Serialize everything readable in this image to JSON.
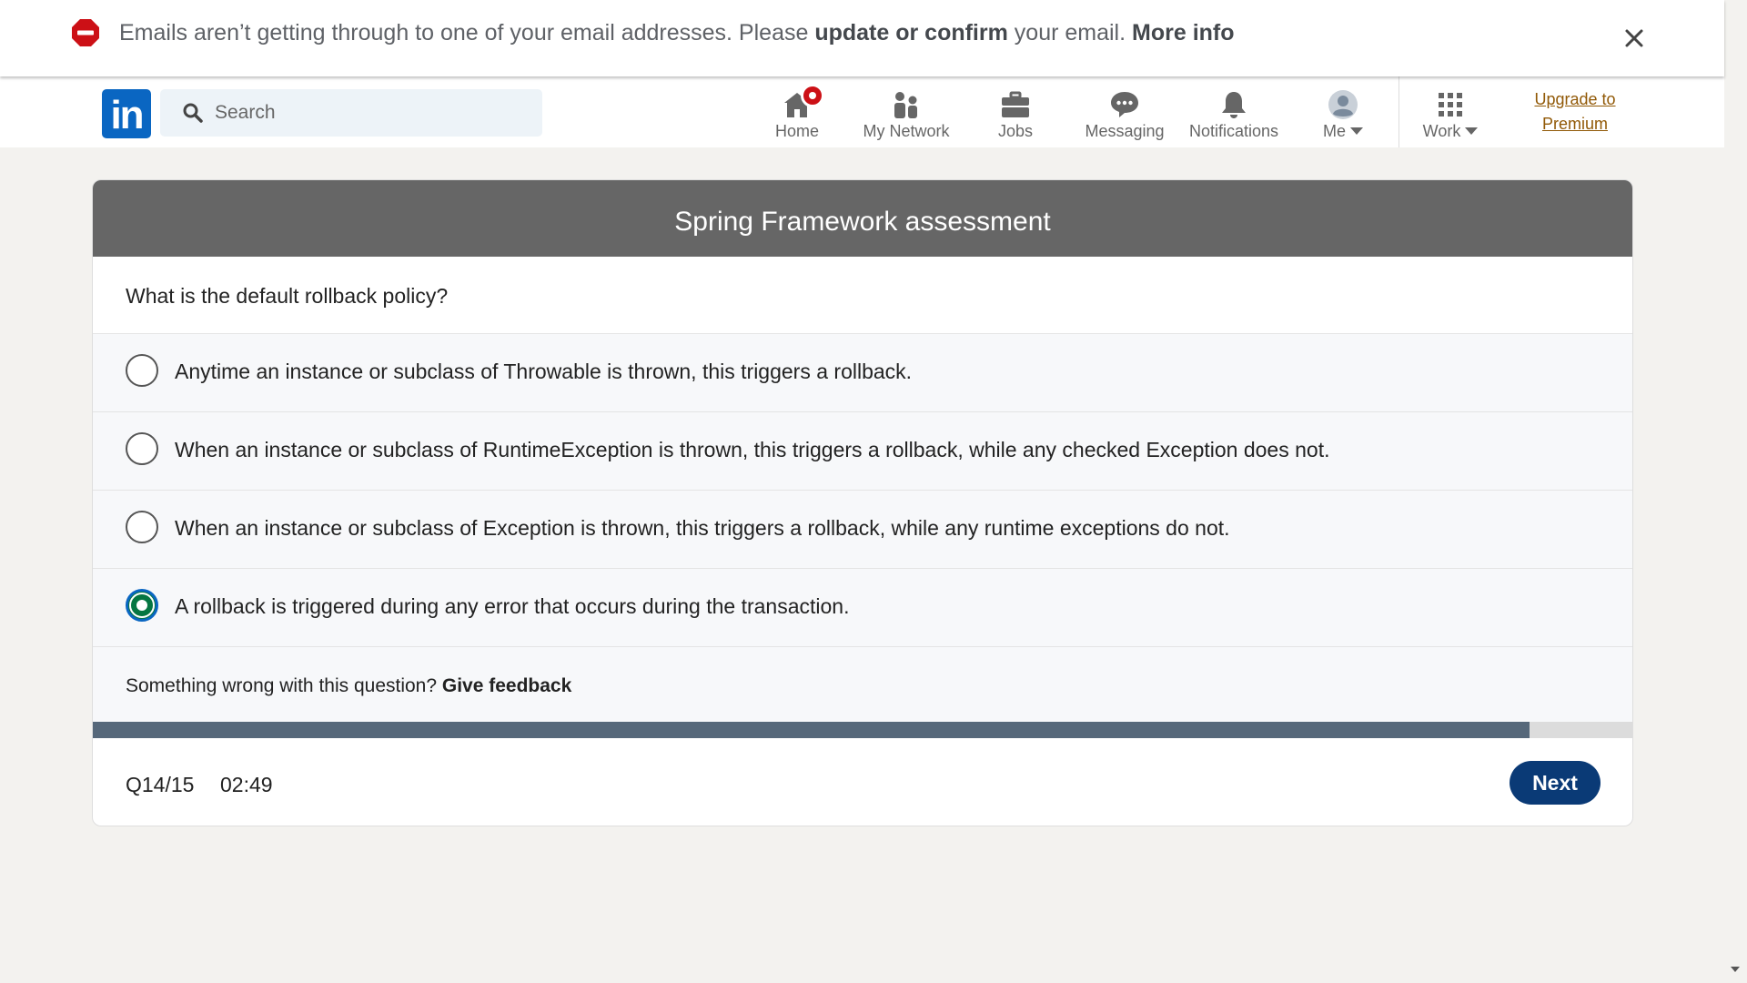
{
  "banner": {
    "text_pre": "Emails aren’t getting through to one of your email addresses. Please ",
    "text_bold": "update or confirm",
    "text_post": " your email. ",
    "link": "More info",
    "icon": "stop-icon",
    "close_icon": "close-icon"
  },
  "nav": {
    "logo": "in",
    "search_placeholder": "Search",
    "items": [
      {
        "label": "Home",
        "icon": "home-icon"
      },
      {
        "label": "My Network",
        "icon": "network-icon"
      },
      {
        "label": "Jobs",
        "icon": "briefcase-icon"
      },
      {
        "label": "Messaging",
        "icon": "messaging-icon"
      },
      {
        "label": "Notifications",
        "icon": "bell-icon"
      },
      {
        "label": "Me",
        "icon": "avatar-icon"
      },
      {
        "label": "Work",
        "icon": "grid-icon"
      }
    ],
    "premium_line1": "Upgrade to",
    "premium_line2": "Premium"
  },
  "assessment": {
    "title": "Spring Framework assessment",
    "question": "What is the default rollback policy?",
    "options": [
      {
        "text": "Anytime an instance or subclass of Throwable is thrown, this triggers a rollback.",
        "selected": false
      },
      {
        "text": "When an instance or subclass of RuntimeException is thrown, this triggers a rollback, while any checked Exception does not.",
        "selected": false
      },
      {
        "text": "When an instance or subclass of Exception is thrown, this triggers a rollback, while any runtime exceptions do not.",
        "selected": false
      },
      {
        "text": "A rollback is triggered during any error that occurs during the transaction.",
        "selected": true
      }
    ],
    "feedback_prefix": "Something wrong with this question?",
    "feedback_link": "Give feedback",
    "progress": 0.933,
    "question_number": "Q14/15",
    "timer": "02:49",
    "next_label": "Next"
  },
  "colors": {
    "brand": "#0a66c2",
    "header_bg": "#666666",
    "selected": "#057642",
    "next_button": "#0a3a76",
    "progress_fill": "#56687a",
    "alert": "#cc1016"
  }
}
